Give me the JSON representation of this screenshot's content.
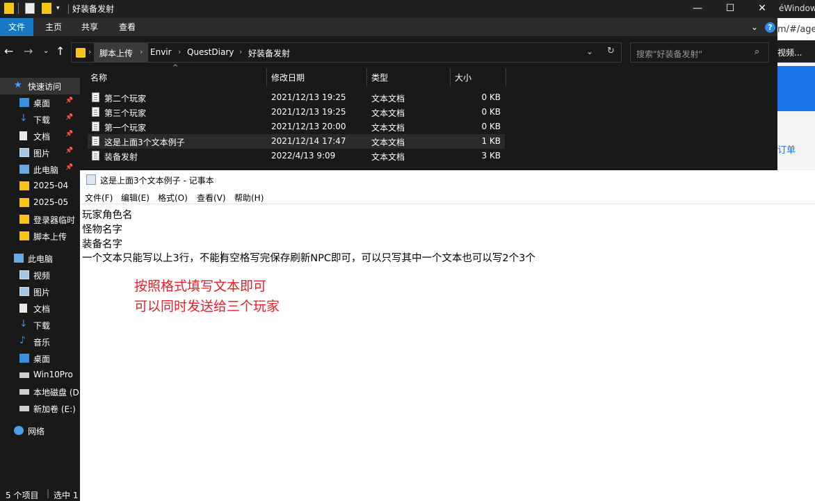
{
  "background_browser": {
    "title_fragment": "éWindows",
    "url_fragment": "m/#/age",
    "bookmark_fragment": "视频...",
    "link_fragment": "订单"
  },
  "explorer": {
    "title": "好装备发射",
    "window_buttons": {
      "minimize": "—",
      "maximize": "☐",
      "close": "✕"
    },
    "ribbon": {
      "tabs": [
        "文件",
        "主页",
        "共享",
        "查看"
      ],
      "help": "?"
    },
    "address": {
      "crumbs": [
        "脚本上传",
        "Envir",
        "QuestDiary",
        "好装备发射"
      ]
    },
    "search_placeholder": "搜索\"好装备发射\"",
    "sidebar": [
      {
        "label": "快速访问",
        "icon": "star-icon",
        "pinned": false,
        "selected": true,
        "indent": 1
      },
      {
        "label": "桌面",
        "icon": "desktop-icon",
        "pinned": true,
        "indent": 2
      },
      {
        "label": "下载",
        "icon": "download-icon",
        "pinned": true,
        "indent": 2
      },
      {
        "label": "文档",
        "icon": "document-icon",
        "pinned": true,
        "indent": 2
      },
      {
        "label": "图片",
        "icon": "picture-icon",
        "pinned": true,
        "indent": 2
      },
      {
        "label": "此电脑",
        "icon": "computer-icon",
        "pinned": true,
        "indent": 2
      },
      {
        "label": "2025-04",
        "icon": "folder-icon",
        "pinned": false,
        "indent": 2
      },
      {
        "label": "2025-05",
        "icon": "folder-icon",
        "pinned": false,
        "indent": 2
      },
      {
        "label": "登录器临时",
        "icon": "folder-icon",
        "pinned": false,
        "indent": 2
      },
      {
        "label": "脚本上传",
        "icon": "folder-icon",
        "pinned": false,
        "indent": 2
      },
      {
        "label": "此电脑",
        "icon": "computer-icon",
        "pinned": false,
        "indent": 1
      },
      {
        "label": "视频",
        "icon": "video-icon",
        "pinned": false,
        "indent": 2
      },
      {
        "label": "图片",
        "icon": "picture-icon",
        "pinned": false,
        "indent": 2
      },
      {
        "label": "文档",
        "icon": "document-icon",
        "pinned": false,
        "indent": 2
      },
      {
        "label": "下载",
        "icon": "download-icon",
        "pinned": false,
        "indent": 2
      },
      {
        "label": "音乐",
        "icon": "music-icon",
        "pinned": false,
        "indent": 2
      },
      {
        "label": "桌面",
        "icon": "desktop-icon",
        "pinned": false,
        "indent": 2
      },
      {
        "label": "Win10Pro",
        "icon": "drive-icon",
        "pinned": false,
        "indent": 2
      },
      {
        "label": "本地磁盘 (D",
        "icon": "drive-icon",
        "pinned": false,
        "indent": 2
      },
      {
        "label": "新加卷 (E:)",
        "icon": "drive-icon",
        "pinned": false,
        "indent": 2
      },
      {
        "label": "网络",
        "icon": "network-icon",
        "pinned": false,
        "indent": 1
      }
    ],
    "columns": [
      "名称",
      "修改日期",
      "类型",
      "大小"
    ],
    "files": [
      {
        "name": "第二个玩家",
        "date": "2021/12/13 19:25",
        "type": "文本文档",
        "size": "0 KB"
      },
      {
        "name": "第三个玩家",
        "date": "2021/12/13 19:25",
        "type": "文本文档",
        "size": "0 KB"
      },
      {
        "name": "第一个玩家",
        "date": "2021/12/13 20:00",
        "type": "文本文档",
        "size": "0 KB"
      },
      {
        "name": "这是上面3个文本例子",
        "date": "2021/12/14 17:47",
        "type": "文本文档",
        "size": "1 KB"
      },
      {
        "name": "装备发射",
        "date": "2022/4/13 9:09",
        "type": "文本文档",
        "size": "3 KB"
      }
    ],
    "status": {
      "count": "5 个项目",
      "selected": "选中 1"
    }
  },
  "notepad": {
    "title": "这是上面3个文本例子 - 记事本",
    "menu": [
      "文件(F)",
      "编辑(E)",
      "格式(O)",
      "查看(V)",
      "帮助(H)"
    ],
    "lines": [
      "玩家角色名",
      "怪物名字",
      "装备名字",
      "一个文本只能写以上3行，不能有空格写完保存刷新NPC即可，可以只写其中一个文本也可以写2个3个"
    ],
    "annotation": [
      "按照格式填写文本即可",
      "可以同时发送给三个玩家"
    ],
    "annotation_color": "#ee1d24"
  }
}
